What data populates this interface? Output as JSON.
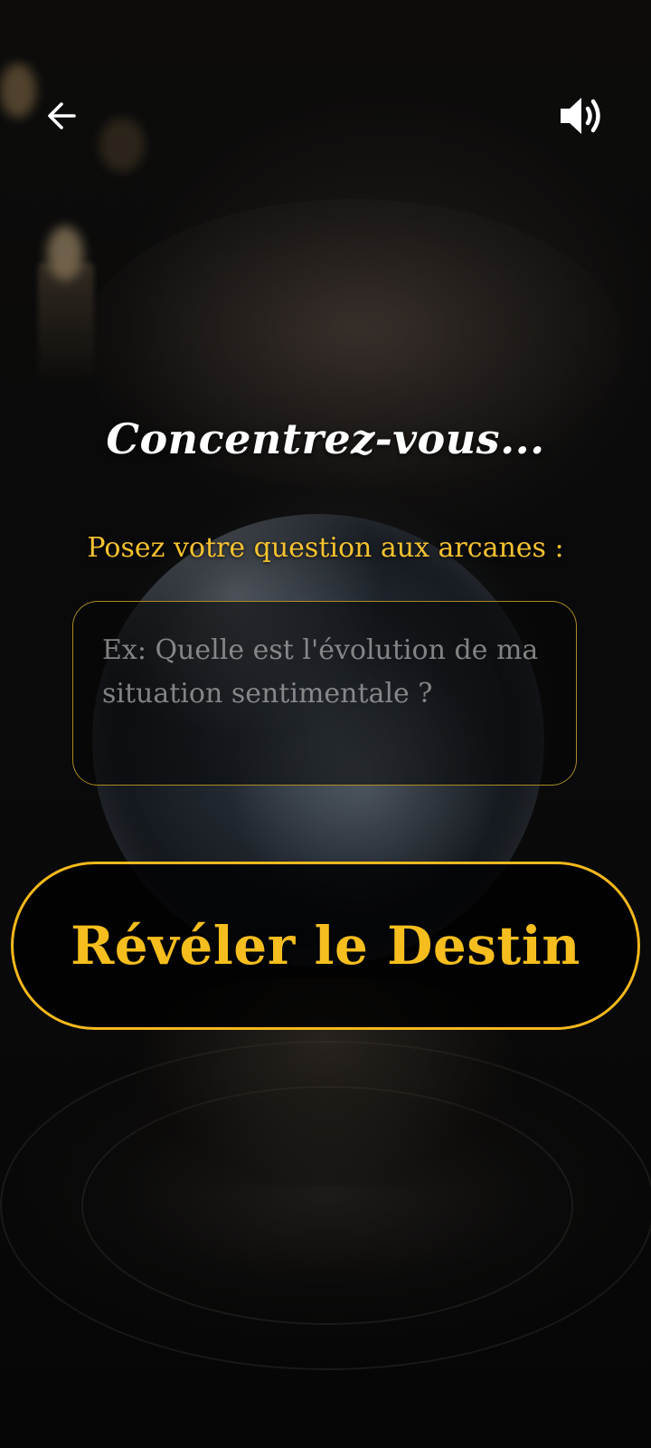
{
  "header": {
    "back_icon": "arrow-left-icon",
    "sound_icon": "speaker-on-icon"
  },
  "main": {
    "title": "Concentrez-vous...",
    "prompt_label": "Posez votre question aux arcanes :",
    "question_field": {
      "value": "",
      "placeholder": "Ex: Quelle est l'évolution de ma situation sentimentale ?"
    },
    "reveal_button_label": "Révéler le Destin"
  },
  "colors": {
    "accent": "#f5be1e",
    "title": "#ffffff",
    "background": "#050505"
  }
}
